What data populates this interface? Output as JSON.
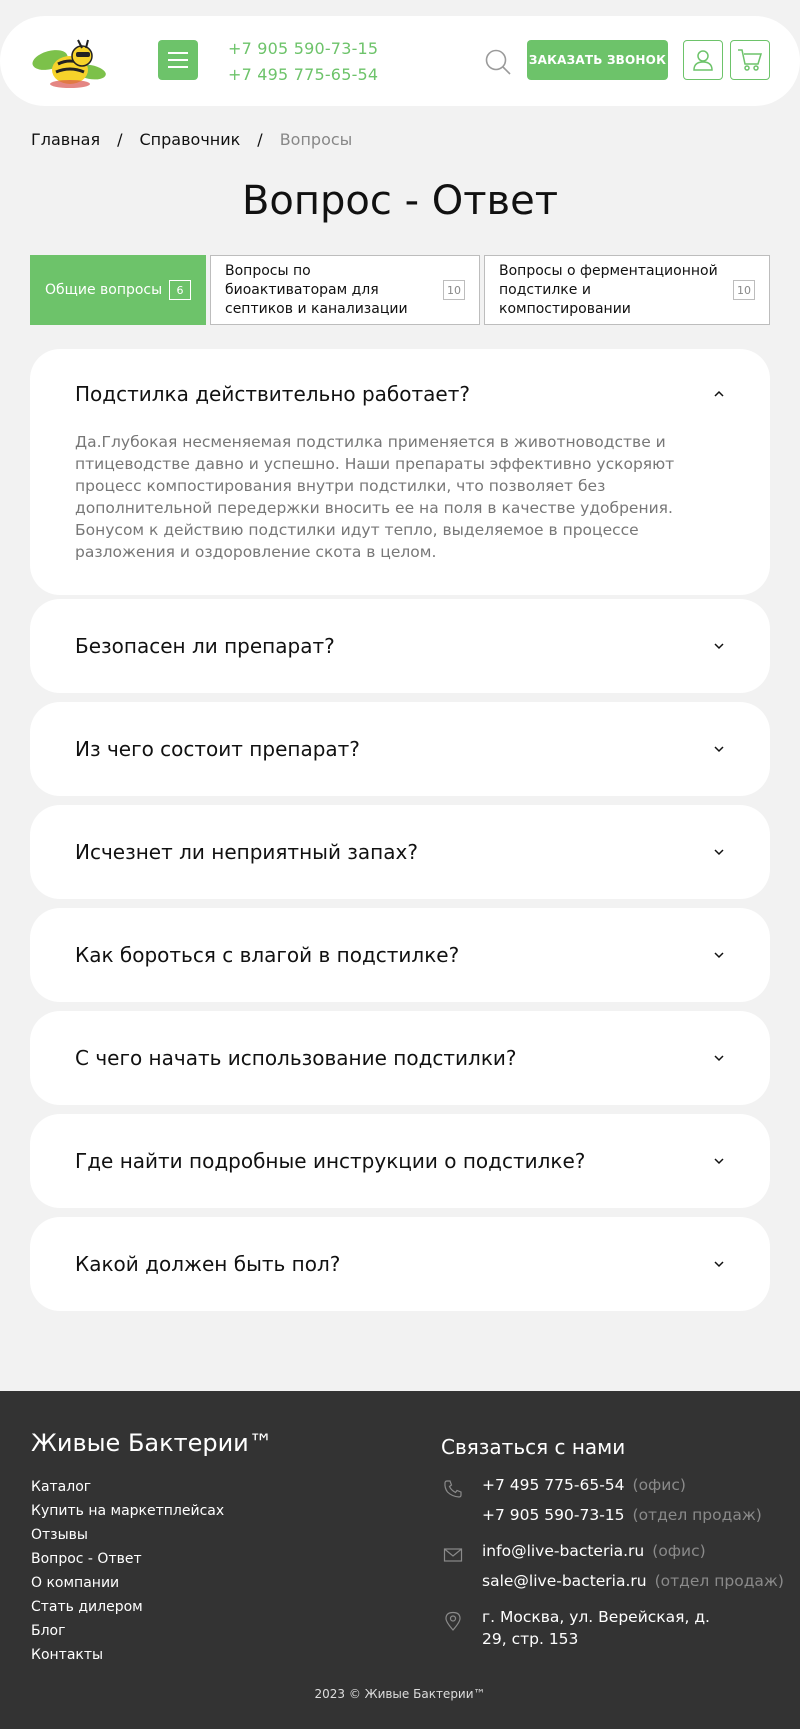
{
  "header": {
    "phones": [
      "+7 905 590-73-15",
      "+7 495 775-65-54"
    ],
    "call_button": "ЗАКАЗАТЬ ЗВОНОК",
    "accent_color": "#6dc36a"
  },
  "breadcrumb": {
    "items": [
      "Главная",
      "Справочник"
    ],
    "separator": "/",
    "current": "Вопросы"
  },
  "page_title": "Вопрос - Ответ",
  "tabs": [
    {
      "label": "Общие вопросы",
      "count": "6",
      "active": true
    },
    {
      "label": "Вопросы по биоактиваторам для септиков и канализации",
      "count": "10",
      "active": false
    },
    {
      "label": "Вопросы о ферментационной подстилке и компостировании",
      "count": "10",
      "active": false
    }
  ],
  "faq": [
    {
      "question": "Подстилка действительно работает?",
      "answer": "Да.Глубокая несменяемая подстилка применяется в животноводстве и птицеводстве давно и успешно. Наши препараты эффективно ускоряют процесс компостирования внутри подстилки, что позволяет без дополнительной передержки вносить ее на поля в качестве удобрения. Бонусом к действию подстилки идут тепло, выделяемое в процессе разложения и оздоровление скота в целом.",
      "expanded": true
    },
    {
      "question": "Безопасен ли препарат?",
      "expanded": false
    },
    {
      "question": "Из чего состоит препарат?",
      "expanded": false
    },
    {
      "question": "Исчезнет ли неприятный запах?",
      "expanded": false
    },
    {
      "question": "Как бороться с влагой в подстилке?",
      "expanded": false
    },
    {
      "question": "С чего начать использование подстилки?",
      "expanded": false
    },
    {
      "question": "Где найти подробные инструкции о подстилке?",
      "expanded": false
    },
    {
      "question": "Какой должен быть пол?",
      "expanded": false
    }
  ],
  "footer": {
    "brand": "Живые Бактерии™",
    "links": [
      "Каталог",
      "Купить на маркетплейсах",
      "Отзывы",
      "Вопрос - Ответ",
      "О компании",
      "Стать дилером",
      "Блог",
      "Контакты"
    ],
    "contact_title": "Связаться с нами",
    "phones": [
      {
        "value": "+7 495 775-65-54",
        "note": "(офис)"
      },
      {
        "value": "+7 905 590-73-15",
        "note": "(отдел продаж)"
      }
    ],
    "emails": [
      {
        "value": "info@live-bacteria.ru",
        "note": "(офис)"
      },
      {
        "value": "sale@live-bacteria.ru",
        "note": "(отдел продаж)"
      }
    ],
    "address_line1": "г. Москва, ул. Верейская, д.",
    "address_line2": "29, стр. 153",
    "copyright": "2023 © Живые Бактерии™"
  }
}
